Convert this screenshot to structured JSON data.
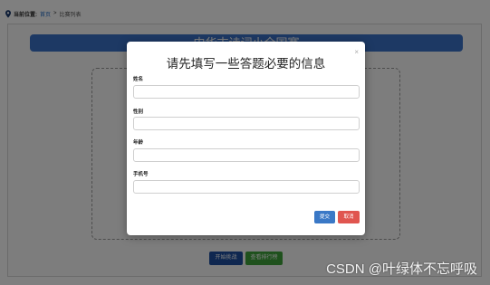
{
  "breadcrumb": {
    "label": "当前位置:",
    "home": "首页",
    "separator": ">",
    "current": "比赛列表"
  },
  "page": {
    "title_bar": "中华古诗词小全国赛",
    "start_button": "开始挑战",
    "rank_button": "查看排行榜"
  },
  "modal": {
    "title": "请先填写一些答题必要的信息",
    "close": "×",
    "fields": [
      {
        "label": "姓名",
        "value": "",
        "placeholder": ""
      },
      {
        "label": "性别",
        "value": "",
        "placeholder": ""
      },
      {
        "label": "年龄",
        "value": "",
        "placeholder": ""
      },
      {
        "label": "手机号",
        "value": "",
        "placeholder": ""
      }
    ],
    "submit_label": "提交",
    "cancel_label": "取消"
  },
  "watermark": "CSDN @叶绿体不忘呼吸",
  "colors": {
    "primary": "#3a78c6",
    "danger": "#e0554f",
    "success": "#3ea23a",
    "dark_blue": "#1f4fa0",
    "title_bar": "#3a73c8"
  },
  "icons": {
    "location": "location-pin-icon",
    "close": "close-icon"
  }
}
